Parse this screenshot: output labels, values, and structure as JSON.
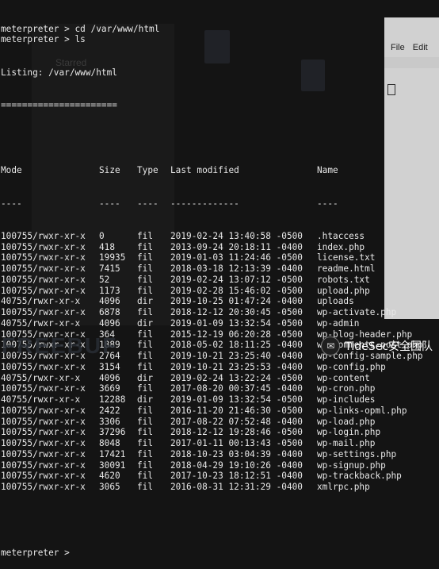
{
  "terminal": {
    "prompt_lines": [
      "meterpreter > cd /var/www/html",
      "meterpreter > ls"
    ],
    "listing_title": "Listing: /var/www/html",
    "separator": "======================",
    "headers": {
      "mode": "Mode",
      "size": "Size",
      "type": "Type",
      "last_modified": "Last modified",
      "name": "Name"
    },
    "header_rule": {
      "mode": "----",
      "size": "----",
      "type": "----",
      "last_modified": "-------------",
      "name": "----"
    },
    "rows": [
      {
        "mode": "100755/rwxr-xr-x",
        "size": "0",
        "type": "fil",
        "date": "2019-02-24 13:40:58 -0500",
        "name": ".htaccess"
      },
      {
        "mode": "100755/rwxr-xr-x",
        "size": "418",
        "type": "fil",
        "date": "2013-09-24 20:18:11 -0400",
        "name": "index.php"
      },
      {
        "mode": "100755/rwxr-xr-x",
        "size": "19935",
        "type": "fil",
        "date": "2019-01-03 11:24:46 -0500",
        "name": "license.txt"
      },
      {
        "mode": "100755/rwxr-xr-x",
        "size": "7415",
        "type": "fil",
        "date": "2018-03-18 12:13:39 -0400",
        "name": "readme.html"
      },
      {
        "mode": "100755/rwxr-xr-x",
        "size": "52",
        "type": "fil",
        "date": "2019-02-24 13:07:12 -0500",
        "name": "robots.txt"
      },
      {
        "mode": "100755/rwxr-xr-x",
        "size": "1173",
        "type": "fil",
        "date": "2019-02-28 15:46:02 -0500",
        "name": "upload.php"
      },
      {
        "mode": "40755/rwxr-xr-x",
        "size": "4096",
        "type": "dir",
        "date": "2019-10-25 01:47:24 -0400",
        "name": "uploads"
      },
      {
        "mode": "100755/rwxr-xr-x",
        "size": "6878",
        "type": "fil",
        "date": "2018-12-12 20:30:45 -0500",
        "name": "wp-activate.php"
      },
      {
        "mode": "40755/rwxr-xr-x",
        "size": "4096",
        "type": "dir",
        "date": "2019-01-09 13:32:54 -0500",
        "name": "wp-admin"
      },
      {
        "mode": "100755/rwxr-xr-x",
        "size": "364",
        "type": "fil",
        "date": "2015-12-19 06:20:28 -0500",
        "name": "wp-blog-header.php"
      },
      {
        "mode": "100755/rwxr-xr-x",
        "size": "1889",
        "type": "fil",
        "date": "2018-05-02 18:11:25 -0400",
        "name": "wp-comments-post.php"
      },
      {
        "mode": "100755/rwxr-xr-x",
        "size": "2764",
        "type": "fil",
        "date": "2019-10-21 23:25:40 -0400",
        "name": "wp-config-sample.php"
      },
      {
        "mode": "100755/rwxr-xr-x",
        "size": "3154",
        "type": "fil",
        "date": "2019-10-21 23:25:53 -0400",
        "name": "wp-config.php"
      },
      {
        "mode": "40755/rwxr-xr-x",
        "size": "4096",
        "type": "dir",
        "date": "2019-02-24 13:22:24 -0500",
        "name": "wp-content"
      },
      {
        "mode": "100755/rwxr-xr-x",
        "size": "3669",
        "type": "fil",
        "date": "2017-08-20 00:37:45 -0400",
        "name": "wp-cron.php"
      },
      {
        "mode": "40755/rwxr-xr-x",
        "size": "12288",
        "type": "dir",
        "date": "2019-01-09 13:32:54 -0500",
        "name": "wp-includes"
      },
      {
        "mode": "100755/rwxr-xr-x",
        "size": "2422",
        "type": "fil",
        "date": "2016-11-20 21:46:30 -0500",
        "name": "wp-links-opml.php"
      },
      {
        "mode": "100755/rwxr-xr-x",
        "size": "3306",
        "type": "fil",
        "date": "2017-08-22 07:52:48 -0400",
        "name": "wp-load.php"
      },
      {
        "mode": "100755/rwxr-xr-x",
        "size": "37296",
        "type": "fil",
        "date": "2018-12-12 19:28:46 -0500",
        "name": "wp-login.php"
      },
      {
        "mode": "100755/rwxr-xr-x",
        "size": "8048",
        "type": "fil",
        "date": "2017-01-11 00:13:43 -0500",
        "name": "wp-mail.php"
      },
      {
        "mode": "100755/rwxr-xr-x",
        "size": "17421",
        "type": "fil",
        "date": "2018-10-23 03:04:39 -0400",
        "name": "wp-settings.php"
      },
      {
        "mode": "100755/rwxr-xr-x",
        "size": "30091",
        "type": "fil",
        "date": "2018-04-29 19:10:26 -0400",
        "name": "wp-signup.php"
      },
      {
        "mode": "100755/rwxr-xr-x",
        "size": "4620",
        "type": "fil",
        "date": "2017-10-23 18:12:51 -0400",
        "name": "wp-trackback.php"
      },
      {
        "mode": "100755/rwxr-xr-x",
        "size": "3065",
        "type": "fil",
        "date": "2016-08-31 12:31:29 -0400",
        "name": "xmlrpc.php"
      }
    ],
    "final_prompt": "meterpreter >"
  },
  "background": {
    "label_starred": "Starred",
    "menu_file": "File",
    "menu_edit": "Edit"
  },
  "watermark": {
    "left_text": "FREEBUF",
    "brand_text": "TideSec安全团队"
  },
  "colors": {
    "terminal_bg": "#141414",
    "terminal_fg": "#e8e8e8"
  }
}
